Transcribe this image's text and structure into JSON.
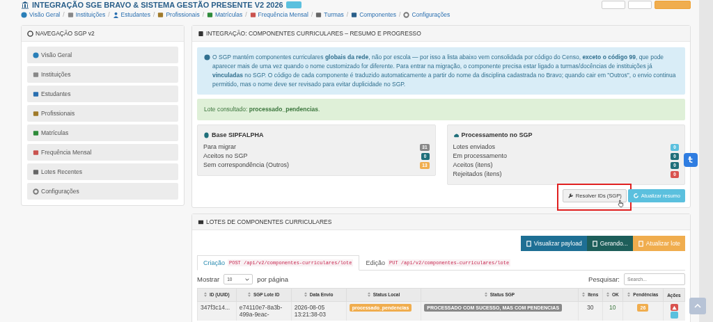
{
  "header": {
    "title": "INTEGRAÇÃO SGE BRAVO & SISTEMA GESTÃO PRESENTE V2 2026"
  },
  "breadcrumb": [
    {
      "label": "Visão Geral"
    },
    {
      "separator": "/",
      "label": "Instituições"
    },
    {
      "separator": "/",
      "label": "Estudantes"
    },
    {
      "separator": "/",
      "label": "Profissionais"
    },
    {
      "separator": "/",
      "label": "Matrículas"
    },
    {
      "separator": "/",
      "label": "Frequência Mensal"
    },
    {
      "separator": "/",
      "label": "Turmas"
    },
    {
      "separator": "/",
      "label": "Componentes"
    },
    {
      "separator": "/",
      "label": "Configurações"
    }
  ],
  "sidebar": {
    "title": "NAVEGAÇÃO SGP v2",
    "items": [
      {
        "label": "Visão Geral"
      },
      {
        "label": "Instituições"
      },
      {
        "label": "Estudantes"
      },
      {
        "label": "Profissionais"
      },
      {
        "label": "Matrículas"
      },
      {
        "label": "Frequência Mensal"
      },
      {
        "label": "Lotes Recentes"
      },
      {
        "label": "Configurações"
      }
    ]
  },
  "summary": {
    "title": "INTEGRAÇÃO: COMPONENTES CURRICULARES – RESUMO E PROGRESSO",
    "info_text": "O SGP mantém componentes curriculares **globais da rede**, não por escola — por isso a lista abaixo vem consolidada por código do Censo, **exceto o código 99**, que pode aparecer mais de uma vez quando o nome customizado for diferente. Para entrar na migração, o componente precisa estar ligado a turmas/docências de instituições já **vinculadas** no SGP. O código de cada componente é traduzido automaticamente a partir do nome da disciplina cadastrada no Bravo; quando cair em \"Outros\", o envio continua permitido, mas o nome deve ser revisado para evitar duplicidade no SGP.",
    "status_text": "Lote consultado: **processado_pendencias**.",
    "boxes": [
      {
        "title": "Base SIPFALPHA",
        "rows": [
          {
            "label": "Para migrar",
            "value": "31",
            "color": "#888888"
          },
          {
            "label": "Aceitos no SGP",
            "value": "0",
            "color": "#1f6f7a"
          },
          {
            "label": "Sem correspondência (Outros)",
            "value": "13",
            "color": "#f0ad4e"
          }
        ]
      },
      {
        "title": "Processamento no SGP",
        "rows": [
          {
            "label": "Lotes enviados",
            "value": "0",
            "color": "#5bc0de"
          },
          {
            "label": "Em processamento",
            "value": "0",
            "color": "#1f6f7a"
          },
          {
            "label": "Aceitos (itens)",
            "value": "0",
            "color": "#1f6f7a"
          },
          {
            "label": "Rejeitados (itens)",
            "value": "0",
            "color": "#d9534f"
          }
        ]
      }
    ],
    "buttons": [
      {
        "label": "Resolver IDs (SGP)",
        "kind": "default",
        "highlighted": true
      },
      {
        "label": "Atualizar resumo",
        "kind": "info",
        "highlighted": false
      }
    ]
  },
  "lotes": {
    "title": "LOTES DE COMPONENTES CURRICULARES",
    "buttons": [
      {
        "label": "Visualizar payload",
        "kind": "primary"
      },
      {
        "label": "Gerando...",
        "kind": "dark"
      },
      {
        "label": "Atualizar lote",
        "kind": "warning"
      }
    ],
    "tabs": [
      {
        "label": "Criação",
        "method": "POST",
        "path": "/api/v2/componentes-curriculares/lote",
        "selected": true
      },
      {
        "label": "Edição",
        "method": "PUT",
        "path": "/api/v2/componentes-curriculares/lote",
        "selected": false
      }
    ],
    "length_before": "Mostrar",
    "length_value": "10",
    "length_after": "por página",
    "search_label": "Pesquisar:",
    "search_placeholder": "Search...",
    "columns": [
      {
        "label": "ID (UUID)",
        "sortable": true
      },
      {
        "label": "SGP Lote ID",
        "sortable": true
      },
      {
        "label": "Data Envio",
        "sortable": true
      },
      {
        "label": "Status Local",
        "sortable": true
      },
      {
        "label": "Status SGP",
        "sortable": true
      },
      {
        "label": "Itens",
        "sortable": true
      },
      {
        "label": "OK",
        "sortable": true
      },
      {
        "label": "Pendências",
        "sortable": true
      },
      {
        "label": "Ações",
        "sortable": false
      }
    ],
    "rows": [
      {
        "id": "347f3c14...",
        "sgp_id": "e74110e7-8a3b-499a-9eac-",
        "date": "2026-08-05 13:21:38-03",
        "status_local": "processado_pendencias",
        "status_sgp": "PROCESSADO COM SUCESSO, MAS COM PENDENCIAS",
        "itens": "30",
        "ok": "10",
        "pendencias": "26"
      }
    ]
  }
}
